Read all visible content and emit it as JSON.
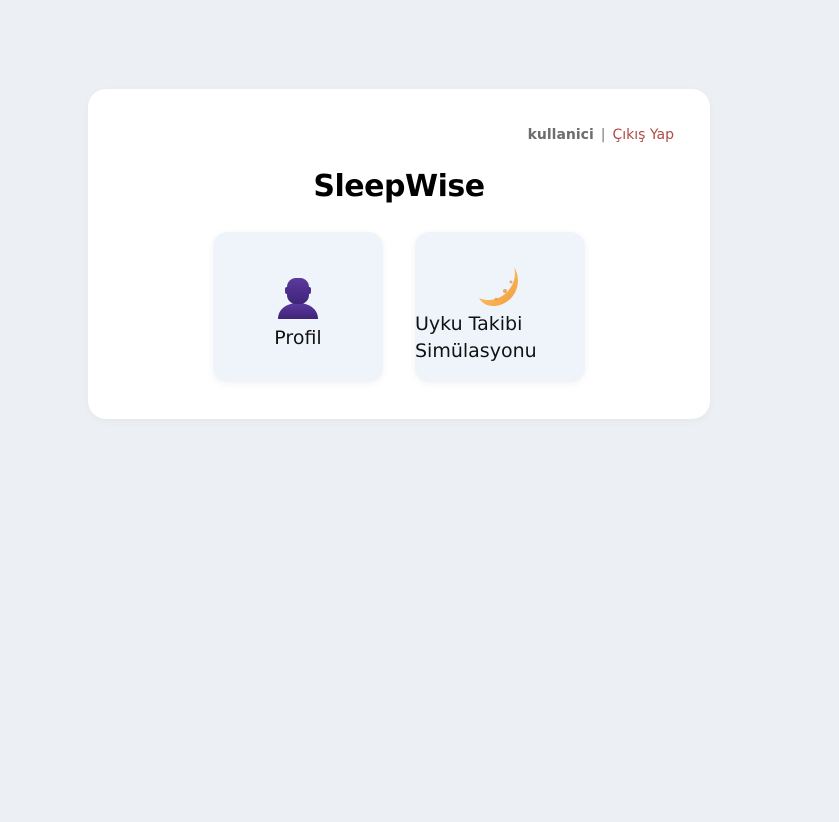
{
  "header": {
    "username": "kullanici",
    "separator": "|",
    "logout_label": "Çıkış Yap"
  },
  "app": {
    "title": "SleepWise"
  },
  "cards": [
    {
      "label": "Profil",
      "icon": "person-icon"
    },
    {
      "label": "Uyku Takibi Simülasyonu",
      "icon": "crescent-moon-icon"
    }
  ],
  "colors": {
    "background": "#eceff3",
    "panel": "#ffffff",
    "card": "#eff4fb",
    "logout": "#b04a42",
    "person_icon": "#4e2d8c",
    "moon_icon": "#f6b04b"
  }
}
